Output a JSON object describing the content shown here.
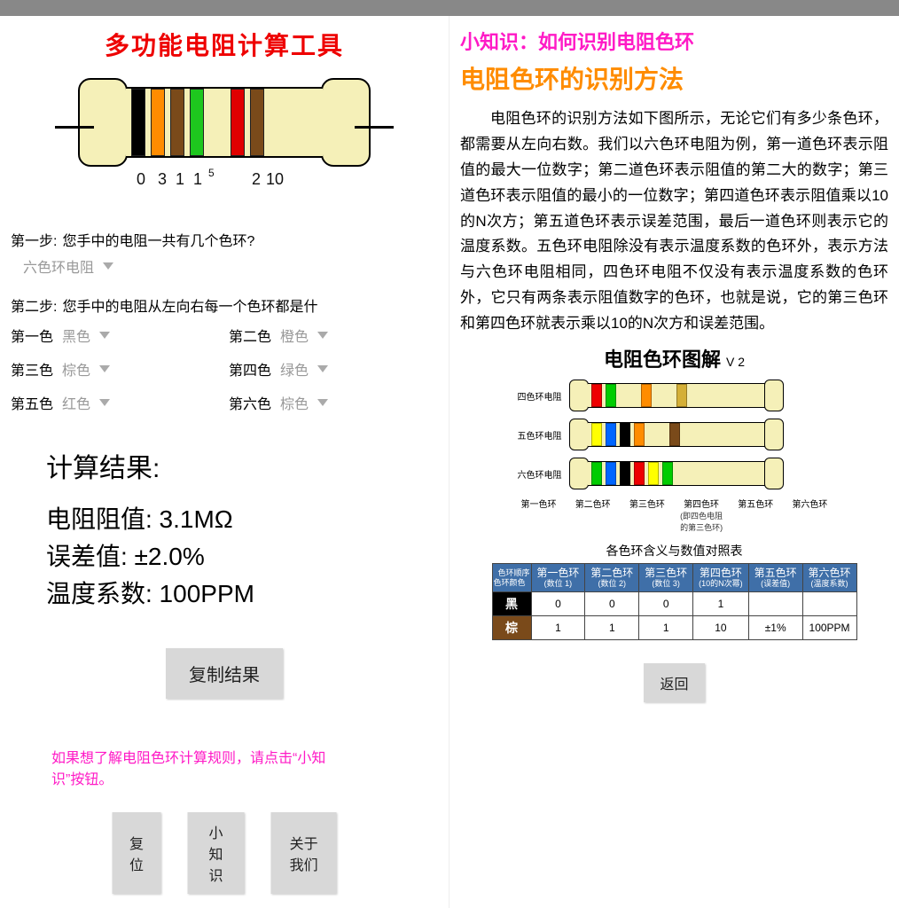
{
  "left": {
    "title": "多功能电阻计算工具",
    "band_values": {
      "d1": "0",
      "d2": "3",
      "d3": "1",
      "d4": "1",
      "exp": "5",
      "tol": "2",
      "tmp": "10"
    },
    "step1": {
      "label": "第一步:",
      "text": "您手中的电阻一共有几个色环?"
    },
    "type_select": "六色环电阻",
    "step2": {
      "label": "第二步:",
      "text": "您手中的电阻从左向右每一个色环都是什"
    },
    "colors": {
      "c1": {
        "label": "第一色",
        "value": "黑色"
      },
      "c2": {
        "label": "第二色",
        "value": "橙色"
      },
      "c3": {
        "label": "第三色",
        "value": "棕色"
      },
      "c4": {
        "label": "第四色",
        "value": "绿色"
      },
      "c5": {
        "label": "第五色",
        "value": "红色"
      },
      "c6": {
        "label": "第六色",
        "value": "棕色"
      }
    },
    "result": {
      "title": "计算结果:",
      "line1": "电阻阻值: 3.1MΩ",
      "line2": "误差值: ±2.0%",
      "line3": "温度系数: 100PPM"
    },
    "copy_btn": "复制结果",
    "hint": "如果想了解电阻色环计算规则，请点击“小知识”按钮。",
    "btn_reset": "复位",
    "btn_tips": "小知识",
    "btn_about": "关于我们"
  },
  "right": {
    "tip_title": "小知识：如何识别电阻色环",
    "sub_title": "电阻色环的识别方法",
    "body": "电阻色环的识别方法如下图所示，无论它们有多少条色环，都需要从左向右数。我们以六色环电阻为例，第一道色环表示阻值的最大一位数字；第二道色环表示阻值的第二大的数字；第三道色环表示阻值的最小的一位数字；第四道色环表示阻值乘以10的N次方；第五道色环表示误差范围，最后一道色环则表示它的温度系数。五色环电阻除没有表示温度系数的色环外，表示方法与六色环电阻相同，四色环电阻不仅没有表示温度系数的色环外，它只有两条表示阻值数字的色环，也就是说，它的第三色环和第四色环就表示乘以10的N次方和误差范围。",
    "diagram_title": "电阻色环图解",
    "diagram_ver": "V 2",
    "rows": {
      "r4": "四色环电阻",
      "r5": "五色环电阻",
      "r6": "六色环电阻"
    },
    "pointer_labels": [
      "第一色环",
      "第二色环",
      "第三色环",
      "第四色环",
      "第五色环",
      "第六色环"
    ],
    "pointer_note1": "(即四色电阻",
    "pointer_note2": "的第三色环)",
    "table_caption": "各色环含义与数值对照表",
    "table": {
      "corner_top": "色环顺序",
      "corner_left": "色环颜色",
      "head": [
        {
          "t": "第一色环",
          "s": "(数位 1)"
        },
        {
          "t": "第二色环",
          "s": "(数位 2)"
        },
        {
          "t": "第三色环",
          "s": "(数位 3)"
        },
        {
          "t": "第四色环",
          "s": "(10的N次幂)"
        },
        {
          "t": "第五色环",
          "s": "(误差值)"
        },
        {
          "t": "第六色环",
          "s": "(温度系数)"
        }
      ],
      "rows": [
        {
          "name": "黑",
          "cells": [
            "0",
            "0",
            "0",
            "1",
            "",
            ""
          ]
        },
        {
          "name": "棕",
          "cells": [
            "1",
            "1",
            "1",
            "10",
            "±1%",
            "100PPM"
          ]
        }
      ]
    },
    "back_btn": "返回"
  }
}
